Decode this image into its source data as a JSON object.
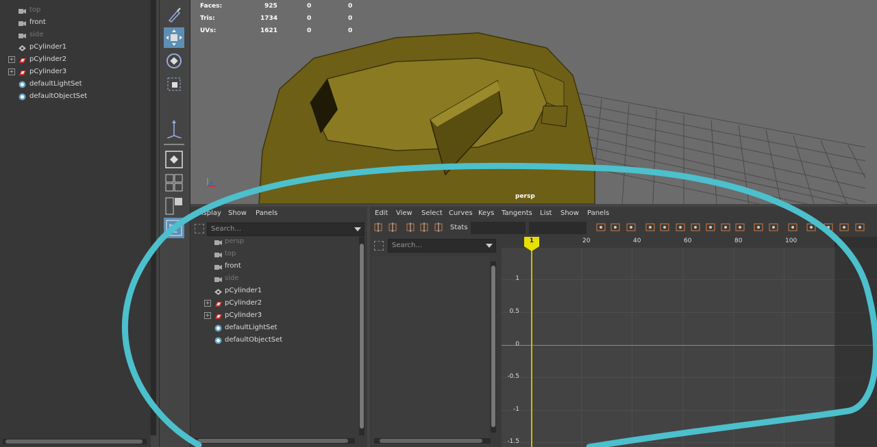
{
  "left_outliner": {
    "items": [
      {
        "label": "top",
        "icon": "camera-icon",
        "dim": true
      },
      {
        "label": "front",
        "icon": "camera-icon",
        "dim": false
      },
      {
        "label": "side",
        "icon": "camera-icon",
        "dim": true
      },
      {
        "label": "pCylinder1",
        "icon": "transform-icon",
        "dim": false
      },
      {
        "label": "pCylinder2",
        "icon": "mesh-icon",
        "dim": false,
        "expandable": true
      },
      {
        "label": "pCylinder3",
        "icon": "mesh-icon",
        "dim": false,
        "expandable": true
      },
      {
        "label": "defaultLightSet",
        "icon": "set-icon",
        "dim": false
      },
      {
        "label": "defaultObjectSet",
        "icon": "set-icon",
        "dim": false
      }
    ]
  },
  "viewport": {
    "hud": [
      {
        "label": "Faces:",
        "a": "925",
        "b": "0",
        "c": "0"
      },
      {
        "label": "Tris:",
        "a": "1734",
        "b": "0",
        "c": "0"
      },
      {
        "label": "UVs:",
        "a": "1621",
        "b": "0",
        "c": "0"
      }
    ],
    "camera_label": "persp"
  },
  "bottom_outliner": {
    "menu": [
      "Display",
      "Show",
      "Panels"
    ],
    "search_placeholder": "Search...",
    "items": [
      {
        "label": "persp",
        "icon": "camera-icon",
        "dim": true
      },
      {
        "label": "top",
        "icon": "camera-icon",
        "dim": true
      },
      {
        "label": "front",
        "icon": "camera-icon",
        "dim": false
      },
      {
        "label": "side",
        "icon": "camera-icon",
        "dim": true
      },
      {
        "label": "pCylinder1",
        "icon": "transform-icon",
        "dim": false
      },
      {
        "label": "pCylinder2",
        "icon": "mesh-icon",
        "dim": false,
        "expandable": true
      },
      {
        "label": "pCylinder3",
        "icon": "mesh-icon",
        "dim": false,
        "expandable": true
      },
      {
        "label": "defaultLightSet",
        "icon": "set-icon",
        "dim": false
      },
      {
        "label": "defaultObjectSet",
        "icon": "set-icon",
        "dim": false
      }
    ]
  },
  "graph_editor": {
    "menu": [
      "Edit",
      "View",
      "Select",
      "Curves",
      "Keys",
      "Tangents",
      "List",
      "Show",
      "Panels"
    ],
    "stats_label": "Stats",
    "search_placeholder": "Search...",
    "current_frame": "1",
    "frame_ticks": [
      "20",
      "40",
      "60",
      "80",
      "100"
    ],
    "value_ticks": [
      "1",
      "0.5",
      "0",
      "-0.5",
      "-1",
      "-1.5"
    ]
  },
  "colors": {
    "annotation": "#4cc0cc",
    "mesh": "#7a6a1a",
    "active_tool": "#5d8fb5",
    "current_frame": "#e8e000"
  }
}
